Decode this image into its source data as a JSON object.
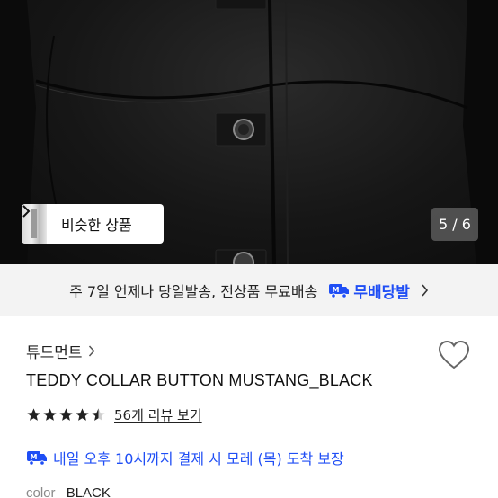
{
  "hero": {
    "similar_label": "비슷한 상품",
    "page_counter": "5 / 6"
  },
  "shipping": {
    "text": "주 7일 언제나 당일발송, 전상품 무료배송",
    "brand": "무배당발"
  },
  "product": {
    "brand": "튜드먼트",
    "name": "TEDDY COLLAR BUTTON MUSTANG_BLACK",
    "rating": 4.5,
    "review_link": "56개 리뷰 보기",
    "delivery_guarantee": "내일 오후 10시까지 결제 시 모레 (목) 도착 보장",
    "color_label": "color",
    "color_value": "BLACK"
  },
  "colors": {
    "accent_blue": "#1f4ef5",
    "shipping_bg": "#f3f3f3"
  }
}
